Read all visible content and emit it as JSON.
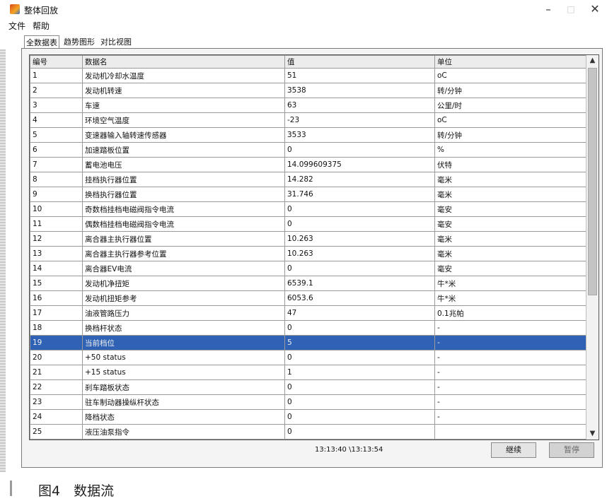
{
  "window": {
    "title": "整体回放"
  },
  "menu": [
    "文件",
    "帮助"
  ],
  "tabs": [
    "全数据表",
    "趋势图形",
    "对比视图"
  ],
  "table": {
    "headers": [
      "编号",
      "数据名",
      "值",
      "单位"
    ],
    "rows": [
      [
        "1",
        "发动机冷却水温度",
        "51",
        "oC"
      ],
      [
        "2",
        "发动机转速",
        "3538",
        "转/分钟"
      ],
      [
        "3",
        "车速",
        "63",
        "公里/时"
      ],
      [
        "4",
        "环境空气温度",
        "-23",
        "oC"
      ],
      [
        "5",
        "变速器输入轴转速传感器",
        "3533",
        "转/分钟"
      ],
      [
        "6",
        "加速踏板位置",
        "0",
        "%"
      ],
      [
        "7",
        "蓄电池电压",
        "14.099609375",
        "伏特"
      ],
      [
        "8",
        "挂档执行器位置",
        "14.282",
        "毫米"
      ],
      [
        "9",
        "换档执行器位置",
        "31.746",
        "毫米"
      ],
      [
        "10",
        "奇数档挂档电磁阀指令电流",
        "0",
        "毫安"
      ],
      [
        "11",
        "偶数档挂档电磁阀指令电流",
        "0",
        "毫安"
      ],
      [
        "12",
        "离合器主执行器位置",
        "10.263",
        "毫米"
      ],
      [
        "13",
        "离合器主执行器参考位置",
        "10.263",
        "毫米"
      ],
      [
        "14",
        "离合器EV电流",
        "0",
        "毫安"
      ],
      [
        "15",
        "发动机净扭矩",
        "6539.1",
        "牛*米"
      ],
      [
        "16",
        "发动机扭矩参考",
        "6053.6",
        "牛*米"
      ],
      [
        "17",
        "油液管路压力",
        "47",
        "0.1兆帕"
      ],
      [
        "18",
        "换档杆状态",
        "0",
        "-"
      ],
      [
        "19",
        "当前档位",
        "5",
        "-"
      ],
      [
        "20",
        "+50 status",
        "0",
        "-"
      ],
      [
        "21",
        "+15 status",
        "1",
        "-"
      ],
      [
        "22",
        "刹车踏板状态",
        "0",
        "-"
      ],
      [
        "23",
        "驻车制动器操纵杆状态",
        "0",
        "-"
      ],
      [
        "24",
        "降档状态",
        "0",
        "-"
      ],
      [
        "25",
        "液压油泵指令",
        "0",
        ""
      ]
    ],
    "selected_row": 19
  },
  "time_range": "13:13:40 \\13:13:54",
  "buttons": {
    "continue": "继续",
    "pause": "暂停"
  },
  "caption": "图4　数据流"
}
